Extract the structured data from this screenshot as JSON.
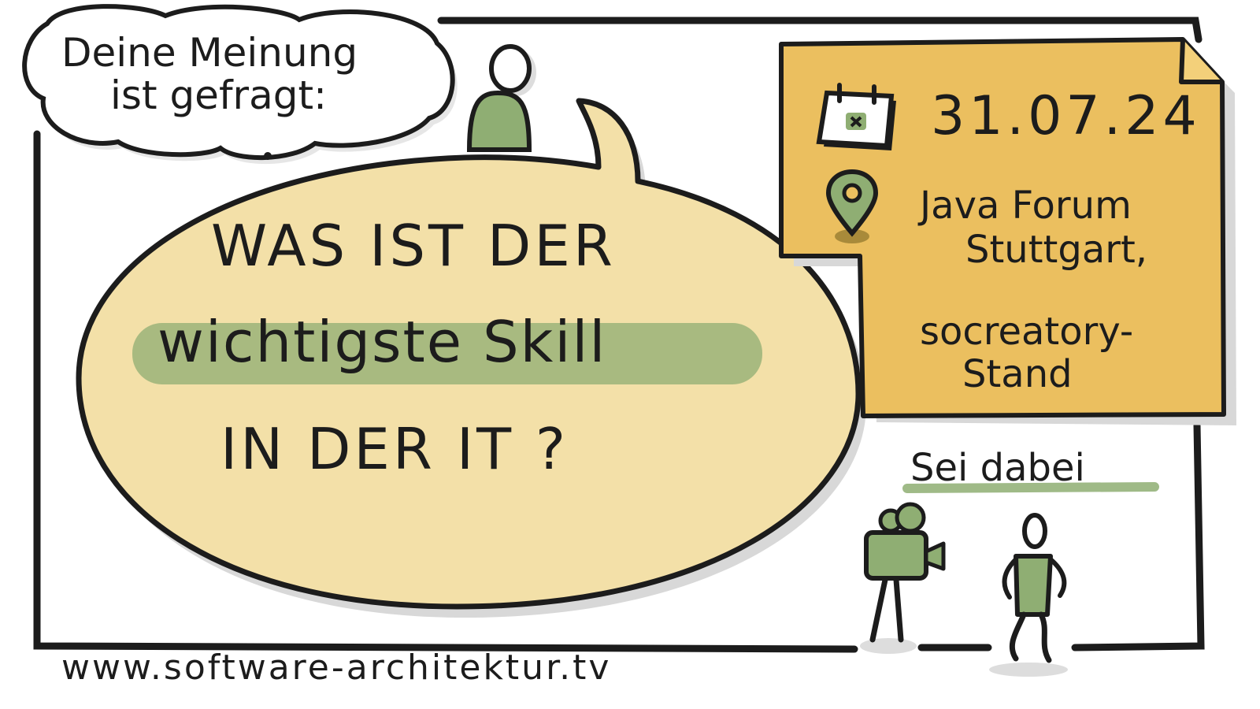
{
  "thought": {
    "line1": "Deine Meinung",
    "line2": "ist gefragt:"
  },
  "question": {
    "line1": "WAS IST DER",
    "line2": "wichtigste Skill",
    "line3": "IN DER IT ?"
  },
  "event": {
    "date": "31.07.24",
    "venue_line1": "Java Forum",
    "venue_line2": "Stuttgart,",
    "venue_line3": "socreatory-",
    "venue_line4": "Stand"
  },
  "call_to_action": "Sei dabei",
  "url": "www.software-architektur.tv",
  "icons": [
    "person-icon",
    "calendar-icon",
    "location-pin-icon",
    "camera-icon",
    "walking-person-icon"
  ],
  "colors": {
    "bubble": "#f3e0a8",
    "note": "#ebbf5f",
    "green": "#8fae73",
    "dark_green": "#6b8f55",
    "shadow": "#d8d8d8",
    "ink": "#1c1c1c"
  }
}
